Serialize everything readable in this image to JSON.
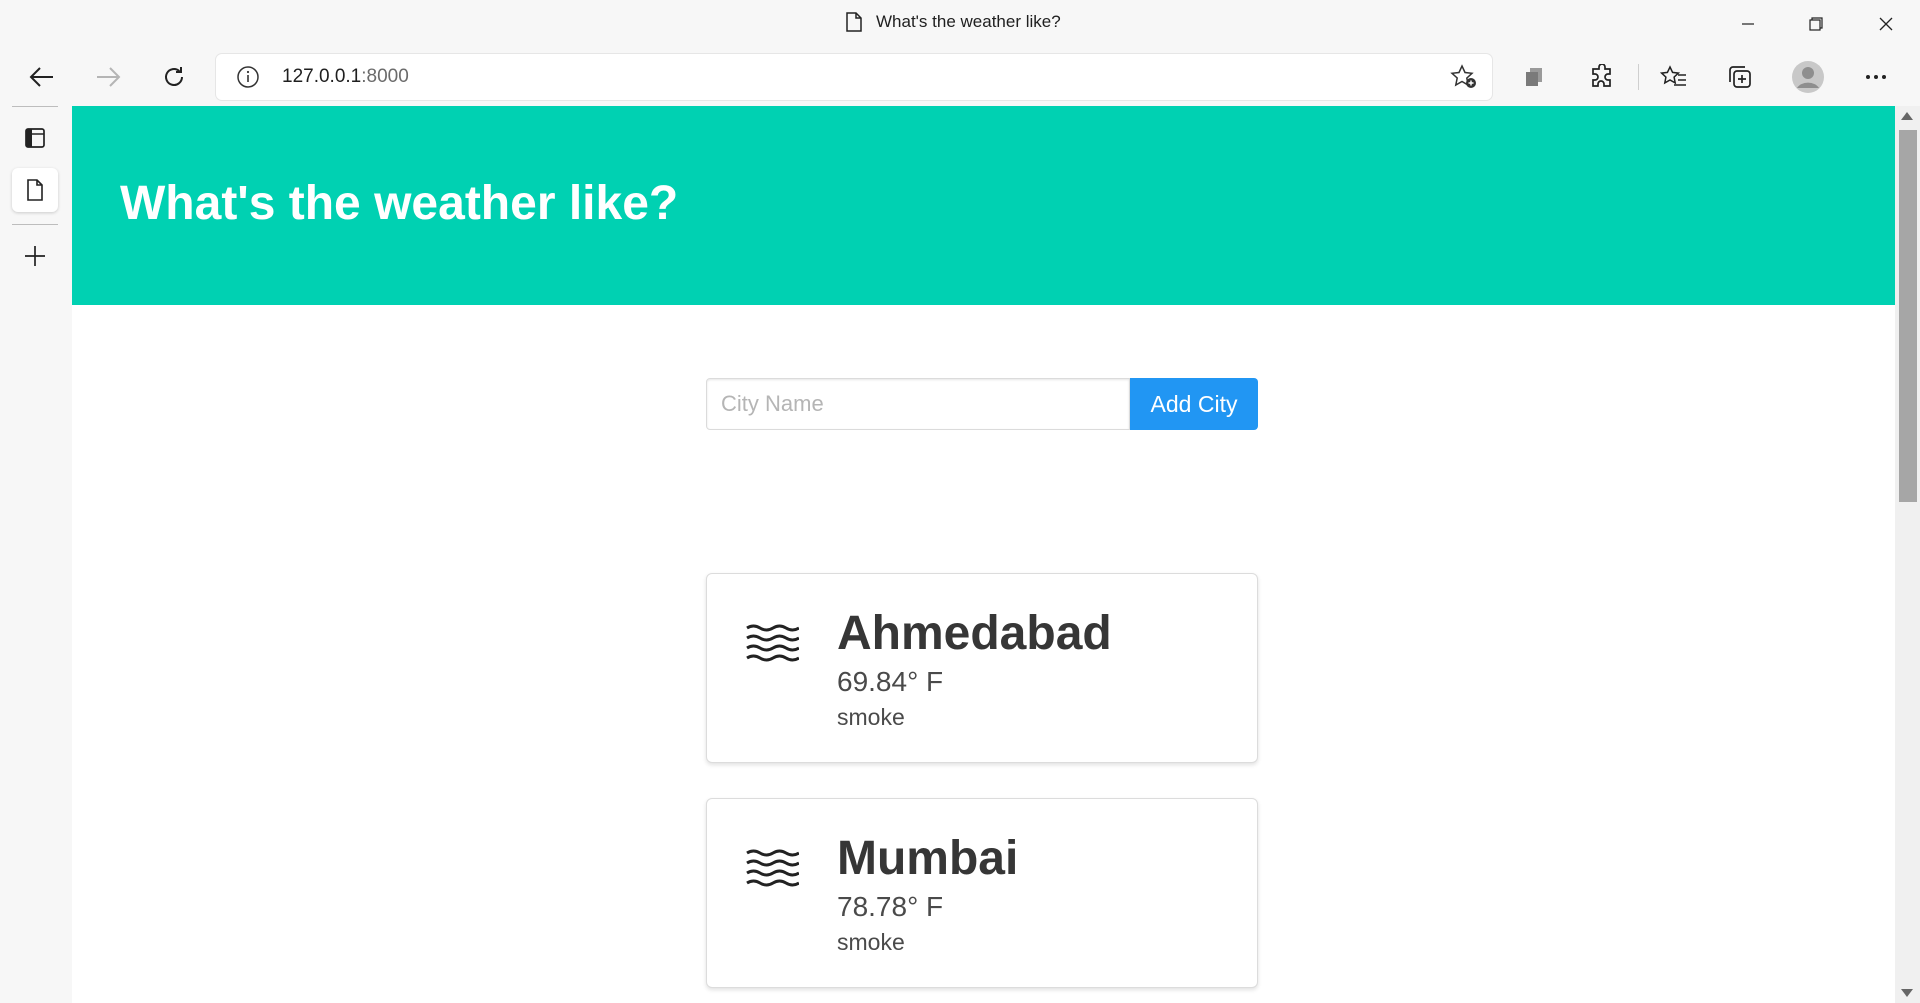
{
  "browser": {
    "tab_title": "What's the weather like?",
    "url_host": "127.0.0.1",
    "url_port": ":8000"
  },
  "page": {
    "heading": "What's the weather like?",
    "city_input_placeholder": "City Name",
    "add_button_label": "Add City",
    "cities": [
      {
        "name": "Ahmedabad",
        "temperature": "69.84° F",
        "description": "smoke",
        "icon": "mist-icon"
      },
      {
        "name": "Mumbai",
        "temperature": "78.78° F",
        "description": "smoke",
        "icon": "mist-icon"
      }
    ]
  },
  "colors": {
    "hero": "#00d1b2",
    "button": "#2196f3"
  }
}
